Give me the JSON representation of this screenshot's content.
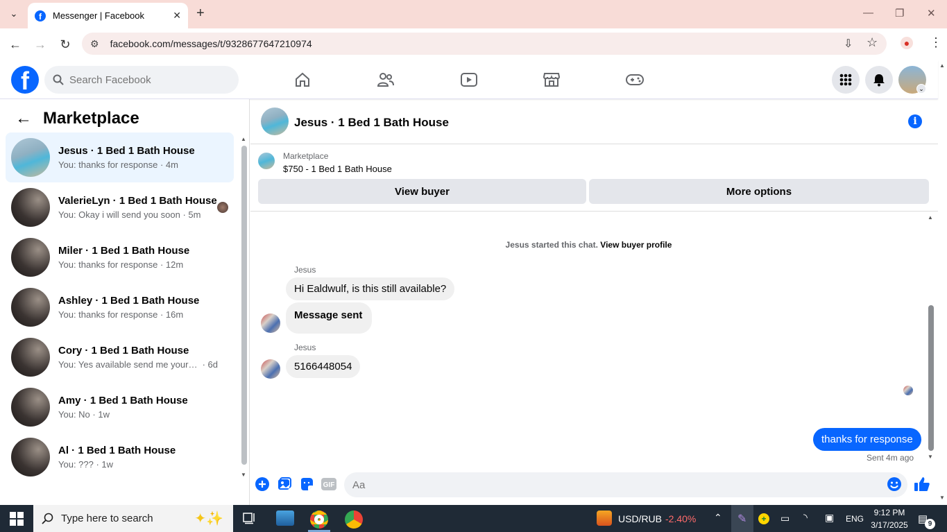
{
  "browser": {
    "tab_title": "Messenger | Facebook",
    "url": "facebook.com/messages/t/9328677647210974"
  },
  "header": {
    "search_placeholder": "Search Facebook"
  },
  "sidebar": {
    "title": "Marketplace",
    "conversations": [
      {
        "name": "Jesus · 1 Bed 1 Bath House",
        "preview": "You: thanks for response",
        "time": "4m",
        "active": true
      },
      {
        "name": "ValerieLyn · 1 Bed 1 Bath House",
        "preview": "You: Okay i will send you soon",
        "time": "5m"
      },
      {
        "name": "Miler · 1 Bed 1 Bath House",
        "preview": "You: thanks for response",
        "time": "12m"
      },
      {
        "name": "Ashley · 1 Bed 1 Bath House",
        "preview": "You: thanks for response",
        "time": "16m"
      },
      {
        "name": "Cory · 1 Bed 1 Bath House",
        "preview": "You: Yes available send me your nu...",
        "time": "6d"
      },
      {
        "name": "Amy · 1 Bed 1 Bath House",
        "preview": "You: No",
        "time": "1w"
      },
      {
        "name": "Al · 1 Bed 1 Bath House",
        "preview": "You: ???",
        "time": "1w"
      }
    ]
  },
  "chat": {
    "title": "Jesus · 1 Bed 1 Bath House",
    "listing_label": "Marketplace",
    "listing_price": "$750 - 1 Bed 1 Bath House",
    "view_buyer": "View buyer",
    "more_options": "More options",
    "started_text": "Jesus started this chat.",
    "view_profile": "View buyer profile",
    "messages": [
      {
        "sender": "Jesus",
        "text": "Hi Ealdwulf, is this still available?"
      },
      {
        "text": "Message sent"
      },
      {
        "sender": "Jesus",
        "text": "5166448054"
      }
    ],
    "outgoing": "thanks for response",
    "sent_status": "Sent 4m ago",
    "composer_placeholder": "Aa"
  },
  "taskbar": {
    "search_placeholder": "Type here to search",
    "ticker": "USD/RUB",
    "ticker_change": "-2.40%",
    "lang": "ENG",
    "time": "9:12 PM",
    "date": "3/17/2025",
    "notif_count": "9"
  },
  "colors": {
    "accent": "#0866ff",
    "chrome": "#f8dcd7",
    "taskbar": "#1f2a36"
  }
}
